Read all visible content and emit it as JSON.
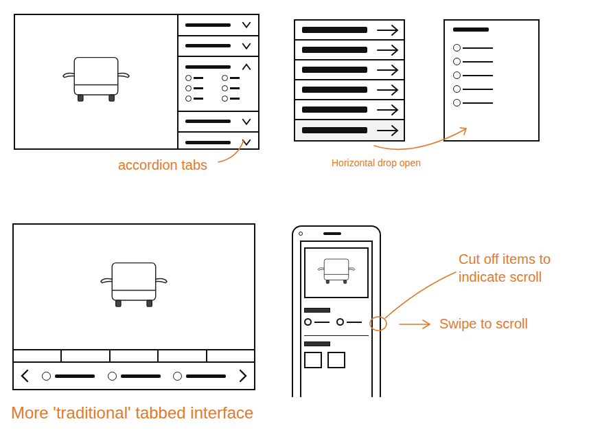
{
  "annotations": {
    "accordion": {
      "text": "accordion tabs"
    },
    "horizontal": {
      "text": "Horizontal drop open"
    },
    "cut_off": {
      "text": "Cut off items to indicate scroll"
    },
    "swipe": {
      "text": "Swipe to scroll"
    },
    "tabbed": {
      "text": "More 'traditional' tabbed interface"
    }
  },
  "accordion": {
    "sections": [
      {
        "expanded": false
      },
      {
        "expanded": false
      },
      {
        "expanded": true,
        "options": [
          {
            "selected": false
          },
          {
            "selected": false
          },
          {
            "selected": false
          },
          {
            "selected": false
          },
          {
            "selected": false
          },
          {
            "selected": false
          }
        ]
      },
      {
        "expanded": false
      },
      {
        "expanded": false
      }
    ]
  },
  "horizontal_list": {
    "rows": [
      {
        "open": false
      },
      {
        "open": false
      },
      {
        "open": false
      },
      {
        "open": false
      },
      {
        "open": false
      },
      {
        "open": true
      }
    ]
  },
  "drop_panel": {
    "options": [
      {
        "selected": false
      },
      {
        "selected": false
      },
      {
        "selected": false
      },
      {
        "selected": false
      },
      {
        "selected": false
      }
    ]
  },
  "tabbed": {
    "tabs": [
      {
        "selected": false
      },
      {
        "selected": false
      },
      {
        "selected": false
      },
      {
        "selected": false
      },
      {
        "selected": false
      }
    ],
    "carousel": [
      {
        "selected": false
      },
      {
        "selected": false
      },
      {
        "selected": false
      }
    ]
  },
  "phone": {
    "swatches": [
      {
        "cut_off": false
      },
      {
        "cut_off": false
      },
      {
        "cut_off": true
      }
    ],
    "thumbnails": [
      {
        "selected": false
      },
      {
        "selected": false
      }
    ]
  }
}
